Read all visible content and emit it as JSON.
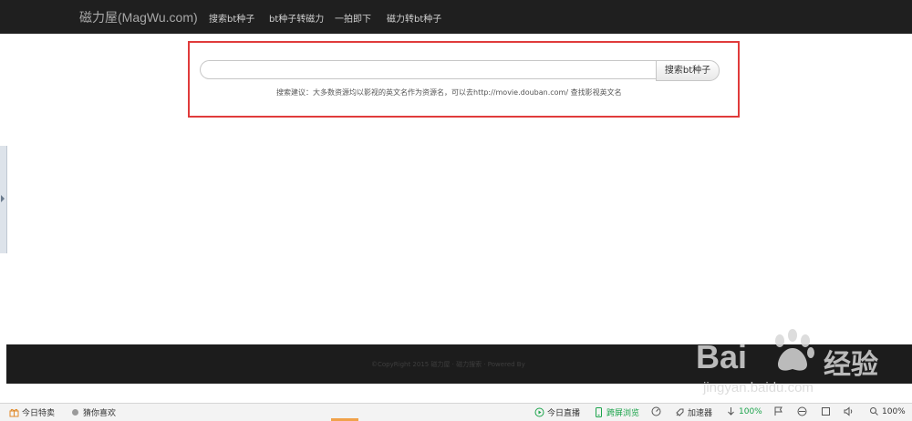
{
  "header": {
    "brand": "磁力屋(MagWu.com)",
    "nav": [
      "搜索bt种子",
      "bt种子转磁力",
      "一拍即下",
      "磁力转bt种子"
    ]
  },
  "search": {
    "value": "",
    "placeholder": "",
    "button_label": "搜索bt种子",
    "hint": "搜索建议：大多数资源均以影视的英文名作为资源名，可以去http://movie.douban.com/ 查找影视英文名"
  },
  "footer": {
    "text": "©CopyRight 2015 磁力屋 · 磁力搜索 · Powered By"
  },
  "watermark": {
    "brand": "Bai",
    "brand_suffix": "经验",
    "url": "jingyan.baidu.com"
  },
  "statusbar": {
    "left": [
      "今日特卖",
      "猜你喜欢"
    ],
    "right": [
      "今日直播",
      "跨屏浏览",
      "加速器",
      "100%",
      "100%"
    ]
  },
  "colors": {
    "topbar": "#1f1f1f",
    "highlight_border": "#e03b3b",
    "footer": "#1c1c1c",
    "statusbar": "#f3f3f3",
    "accent_green": "#1aa34a"
  }
}
